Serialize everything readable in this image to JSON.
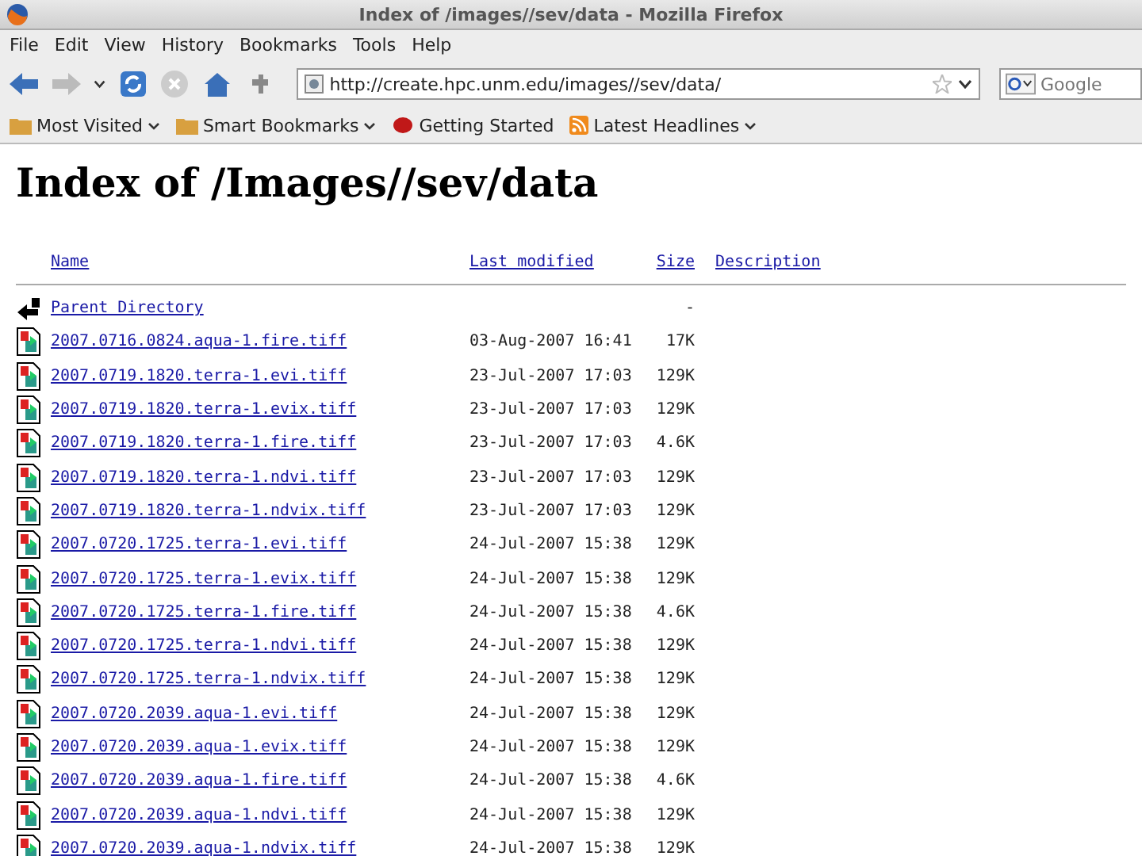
{
  "window": {
    "title": "Index of /images//sev/data - Mozilla Firefox"
  },
  "menu": [
    "File",
    "Edit",
    "View",
    "History",
    "Bookmarks",
    "Tools",
    "Help"
  ],
  "address": {
    "value": "http://create.hpc.unm.edu/images//sev/data/"
  },
  "search": {
    "placeholder": "Google"
  },
  "bookmarks": [
    {
      "label": "Most Visited",
      "kind": "folder",
      "dropdown": true
    },
    {
      "label": "Smart Bookmarks",
      "kind": "folder",
      "dropdown": true
    },
    {
      "label": "Getting Started",
      "kind": "page",
      "dropdown": false
    },
    {
      "label": "Latest Headlines",
      "kind": "feed",
      "dropdown": true
    }
  ],
  "heading": "Index of /Images//sev/data",
  "columns": [
    "Name",
    "Last modified",
    "Size",
    "Description"
  ],
  "rows": [
    {
      "kind": "parent",
      "name": "Parent Directory",
      "modified": "",
      "size": "-"
    },
    {
      "kind": "image",
      "name": "2007.0716.0824.aqua-1.fire.tiff",
      "modified": "03-Aug-2007 16:41",
      "size": "17K"
    },
    {
      "kind": "image",
      "name": "2007.0719.1820.terra-1.evi.tiff",
      "modified": "23-Jul-2007 17:03",
      "size": "129K"
    },
    {
      "kind": "image",
      "name": "2007.0719.1820.terra-1.evix.tiff",
      "modified": "23-Jul-2007 17:03",
      "size": "129K"
    },
    {
      "kind": "image",
      "name": "2007.0719.1820.terra-1.fire.tiff",
      "modified": "23-Jul-2007 17:03",
      "size": "4.6K"
    },
    {
      "kind": "image",
      "name": "2007.0719.1820.terra-1.ndvi.tiff",
      "modified": "23-Jul-2007 17:03",
      "size": "129K"
    },
    {
      "kind": "image",
      "name": "2007.0719.1820.terra-1.ndvix.tiff",
      "modified": "23-Jul-2007 17:03",
      "size": "129K"
    },
    {
      "kind": "image",
      "name": "2007.0720.1725.terra-1.evi.tiff",
      "modified": "24-Jul-2007 15:38",
      "size": "129K"
    },
    {
      "kind": "image",
      "name": "2007.0720.1725.terra-1.evix.tiff",
      "modified": "24-Jul-2007 15:38",
      "size": "129K"
    },
    {
      "kind": "image",
      "name": "2007.0720.1725.terra-1.fire.tiff",
      "modified": "24-Jul-2007 15:38",
      "size": "4.6K"
    },
    {
      "kind": "image",
      "name": "2007.0720.1725.terra-1.ndvi.tiff",
      "modified": "24-Jul-2007 15:38",
      "size": "129K"
    },
    {
      "kind": "image",
      "name": "2007.0720.1725.terra-1.ndvix.tiff",
      "modified": "24-Jul-2007 15:38",
      "size": "129K"
    },
    {
      "kind": "image",
      "name": "2007.0720.2039.aqua-1.evi.tiff",
      "modified": "24-Jul-2007 15:38",
      "size": "129K"
    },
    {
      "kind": "image",
      "name": "2007.0720.2039.aqua-1.evix.tiff",
      "modified": "24-Jul-2007 15:38",
      "size": "129K"
    },
    {
      "kind": "image",
      "name": "2007.0720.2039.aqua-1.fire.tiff",
      "modified": "24-Jul-2007 15:38",
      "size": "4.6K"
    },
    {
      "kind": "image",
      "name": "2007.0720.2039.aqua-1.ndvi.tiff",
      "modified": "24-Jul-2007 15:38",
      "size": "129K"
    },
    {
      "kind": "image",
      "name": "2007.0720.2039.aqua-1.ndvix.tiff",
      "modified": "24-Jul-2007 15:38",
      "size": "129K"
    }
  ]
}
